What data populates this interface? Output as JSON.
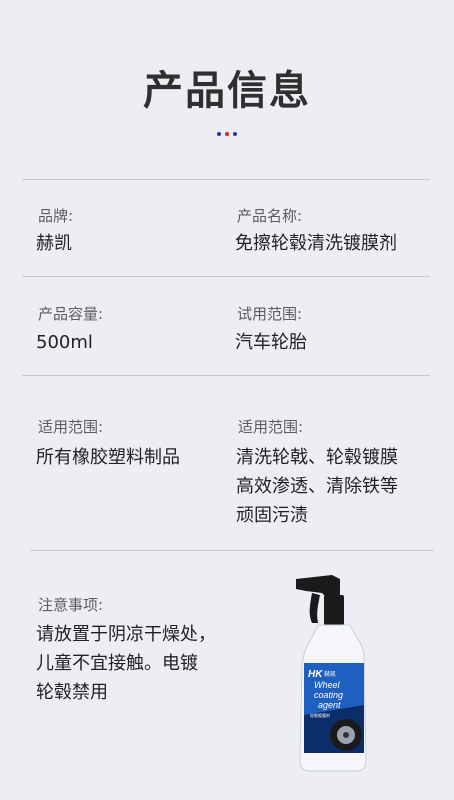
{
  "title": "产品信息",
  "dot_colors": [
    "#2b3a8f",
    "#d9242b",
    "#2b3a8f"
  ],
  "fields": {
    "brand": {
      "label": "品牌:",
      "value": "赫凯"
    },
    "product_name": {
      "label": "产品名称:",
      "value": "免擦轮毂清洗镀膜剂"
    },
    "capacity": {
      "label": "产品容量:",
      "value": "500ml"
    },
    "trial_scope": {
      "label": "试用范围:",
      "value": "汽车轮胎"
    },
    "applicable_left": {
      "label": "适用范围:",
      "value": "所有橡胶塑料制品"
    },
    "applicable_right": {
      "label": "适用范围:",
      "lines": [
        "清洗轮戟、轮毂镀膜",
        "高效渗透、清除铁等",
        "顽固污渍"
      ]
    },
    "notes": {
      "label": "注意事项:",
      "lines": [
        "请放置于阴凉干燥处，",
        "儿童不宜接触。电镀",
        "轮毂禁用"
      ]
    }
  },
  "bottle": {
    "brand_mark": "HK",
    "brand_cn": "赫凯",
    "label_lines": [
      "Wheel",
      "coating",
      "agent"
    ],
    "label_sub": "轮毂镀膜剂",
    "colors": {
      "trigger": "#1a1a1a",
      "body": "#f4f6f9",
      "label_blue": "#1f5fbf",
      "label_dark": "#0b2e6a"
    }
  }
}
